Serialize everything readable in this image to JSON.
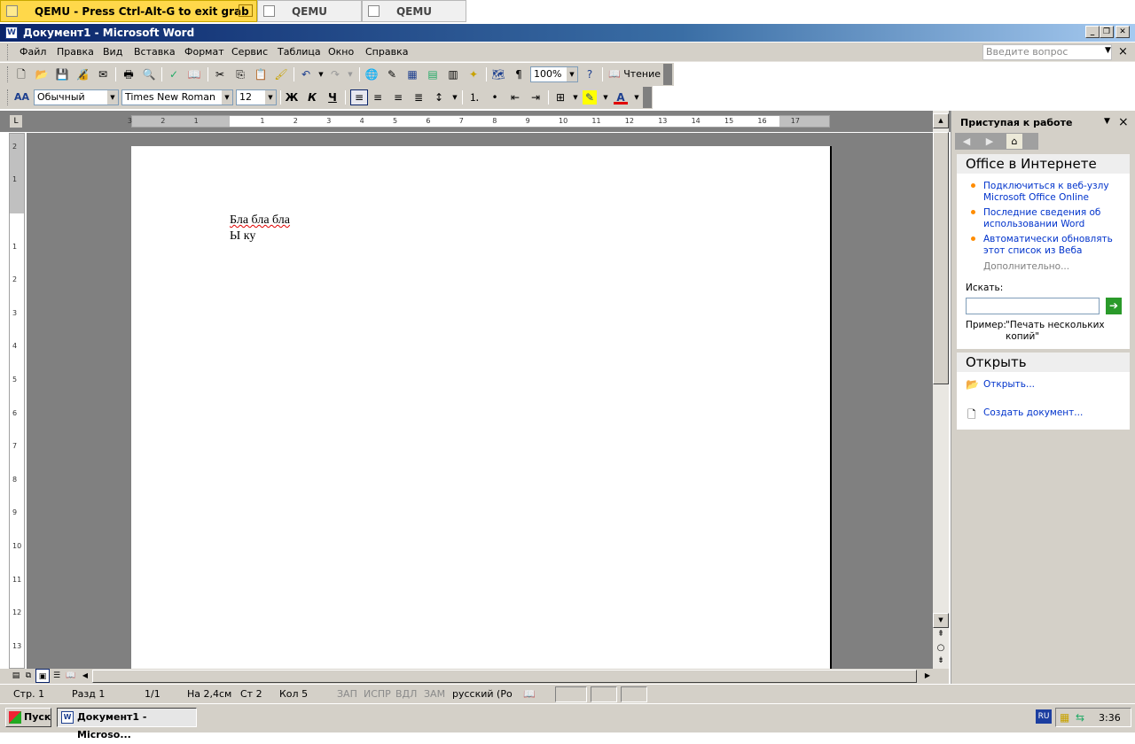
{
  "host_tabs": [
    {
      "label": "QEMU - Press Ctrl-Alt-G to exit grab",
      "active": true
    },
    {
      "label": "QEMU",
      "active": false
    },
    {
      "label": "QEMU",
      "active": false
    }
  ],
  "window": {
    "title": "Документ1 - Microsoft Word",
    "icon": "word-icon",
    "minimize": "_",
    "restore": "❐",
    "close": "✕"
  },
  "menu": {
    "items": [
      "Файл",
      "Правка",
      "Вид",
      "Вставка",
      "Формат",
      "Сервис",
      "Таблица",
      "Окно",
      "Справка"
    ],
    "ask_placeholder": "Введите вопрос",
    "close": "×"
  },
  "standard_toolbar": {
    "zoom": "100%",
    "reading_label": "Чтение"
  },
  "format_toolbar": {
    "style": "Обычный",
    "font": "Times New Roman",
    "size": "12",
    "bold": "Ж",
    "italic": "К",
    "underline": "Ч",
    "style_icon": "AA"
  },
  "ruler": {
    "corner": "L",
    "ticks": [
      "3",
      "2",
      "1",
      "1",
      "2",
      "3",
      "4",
      "5",
      "6",
      "7",
      "8",
      "9",
      "10",
      "11",
      "12",
      "13",
      "14",
      "15",
      "16",
      "17"
    ],
    "vticks": [
      "2",
      "1",
      "1",
      "2",
      "3",
      "4",
      "5",
      "6",
      "7",
      "8",
      "9",
      "10",
      "11",
      "12",
      "13"
    ]
  },
  "document": {
    "lines": [
      "Бла бла бла",
      "Ы ку"
    ]
  },
  "task_pane": {
    "title": "Приступая к работе",
    "section_online": "Office в Интернете",
    "links": [
      "Подключиться к веб-узлу Microsoft Office Online",
      "Последние сведения об использовании Word",
      "Автоматически обновлять этот список из Веба"
    ],
    "more": "Дополнительно...",
    "search_label": "Искать:",
    "example_label": "Пример:",
    "example_text": "\"Печать нескольких копий\"",
    "section_open": "Открыть",
    "open_link": "Открыть...",
    "create_link": "Создать документ..."
  },
  "status": {
    "page": "Стр. 1",
    "section": "Разд 1",
    "pages": "1/1",
    "at": "На 2,4см",
    "line": "Ст 2",
    "col": "Кол 5",
    "rec": "ЗАП",
    "trk": "ИСПР",
    "ext": "ВДЛ",
    "ovr": "ЗАМ",
    "language": "русский (Ро"
  },
  "taskbar": {
    "start": "Пуск",
    "task": "Документ1 - Microso...",
    "lang": "RU",
    "clock": "3:36"
  }
}
